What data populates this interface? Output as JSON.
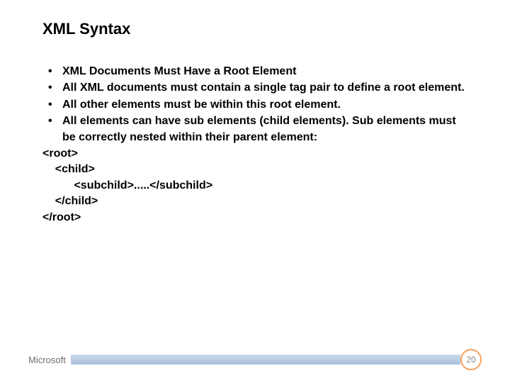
{
  "title": "XML Syntax",
  "bullets": [
    "XML Documents Must Have a Root Element",
    "All XML documents must contain a single tag pair to define a root element.",
    "All other elements must be within this root element.",
    "All elements can have sub elements (child elements). Sub elements must be correctly nested within their parent element:"
  ],
  "code": "<root>\n    <child>\n          <subchild>.....</subchild>\n    </child>\n</root>",
  "footer": {
    "brand": "Microsoft",
    "page": "20"
  }
}
